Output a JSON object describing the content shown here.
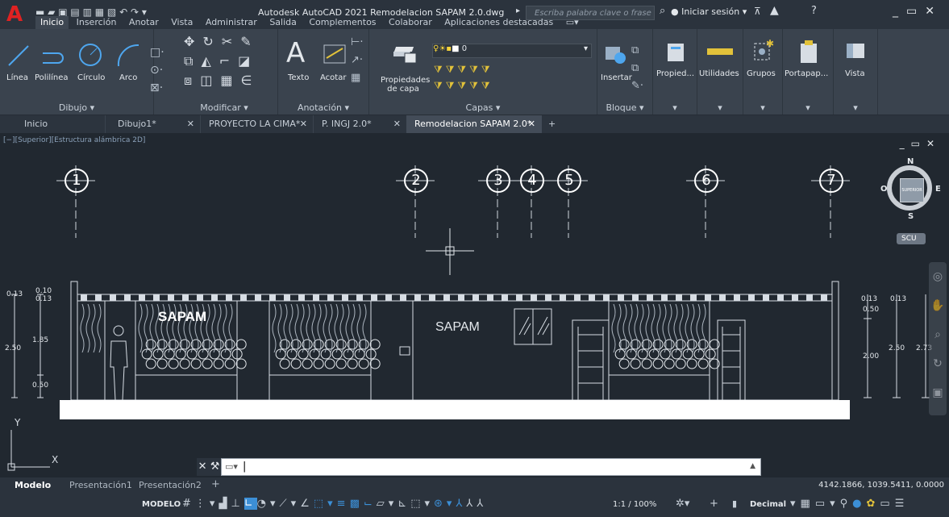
{
  "titlebar": {
    "logo": "A",
    "title": "Autodesk AutoCAD 2021   Remodelacion SAPAM 2.0.dwg",
    "search_placeholder": "Escriba palabra clave o frase",
    "signin_label": "Iniciar sesión"
  },
  "ribbon_tabs": [
    "Inicio",
    "Inserción",
    "Anotar",
    "Vista",
    "Administrar",
    "Salida",
    "Complementos",
    "Colaborar",
    "Aplicaciones destacadas"
  ],
  "ribbon": {
    "dibujo": {
      "title": "Dibujo",
      "linea": "Línea",
      "polilinea": "Polilínea",
      "circulo": "Círculo",
      "arco": "Arco"
    },
    "modificar": {
      "title": "Modificar"
    },
    "anotacion": {
      "title": "Anotación",
      "texto": "Texto",
      "acotar": "Acotar"
    },
    "capas": {
      "title": "Capas",
      "propiedades_1": "Propiedades",
      "propiedades_2": "de capa",
      "layer_value": "0"
    },
    "bloque": {
      "title": "Bloque",
      "insertar": "Insertar"
    },
    "propied": "Propied...",
    "utilidades": "Utilidades",
    "grupos": "Grupos",
    "portapap": "Portapap...",
    "vista": "Vista"
  },
  "doc_tabs": [
    {
      "label": "Inicio"
    },
    {
      "label": "Dibujo1*"
    },
    {
      "label": "PROYECTO LA CIMA*"
    },
    {
      "label": "P. INGJ 2.0*"
    },
    {
      "label": "Remodelacion SAPAM 2.0*"
    }
  ],
  "viewport_label": "[−][Superior][Estructura alámbrica 2D]",
  "viewcube": {
    "north": "N",
    "south": "S",
    "east": "E",
    "west": "O",
    "face": "SUPERIOR",
    "ucs": "SCU"
  },
  "drawing": {
    "axes": [
      "1",
      "2",
      "3",
      "4",
      "5",
      "6",
      "7"
    ],
    "signs": [
      "SAPAM",
      "SAPAM"
    ],
    "dims_left": {
      "top1": "0.13",
      "top2": "0.10",
      "top3": "0.13",
      "h185": "1.85",
      "h250": "2.50",
      "h050": "0.50"
    },
    "dims_right": {
      "a": "0.13",
      "b": "0.13",
      "c": "0.50",
      "d": "2.00",
      "e": "2.50",
      "f": "2.73"
    },
    "ucs_x": "X",
    "ucs_y": "Y"
  },
  "layout_tabs": [
    "Modelo",
    "Presentación1",
    "Presentación2"
  ],
  "coordinates": "4142.1866, 1039.5411, 0.0000",
  "statusbar": {
    "modelo": "MODELO",
    "scale": "1:1 / 100%",
    "units": "Decimal"
  },
  "colors": {
    "accent": "#3c8fd6",
    "logo": "#e02222",
    "background": "#212830",
    "ribbon": "#3a434e"
  }
}
